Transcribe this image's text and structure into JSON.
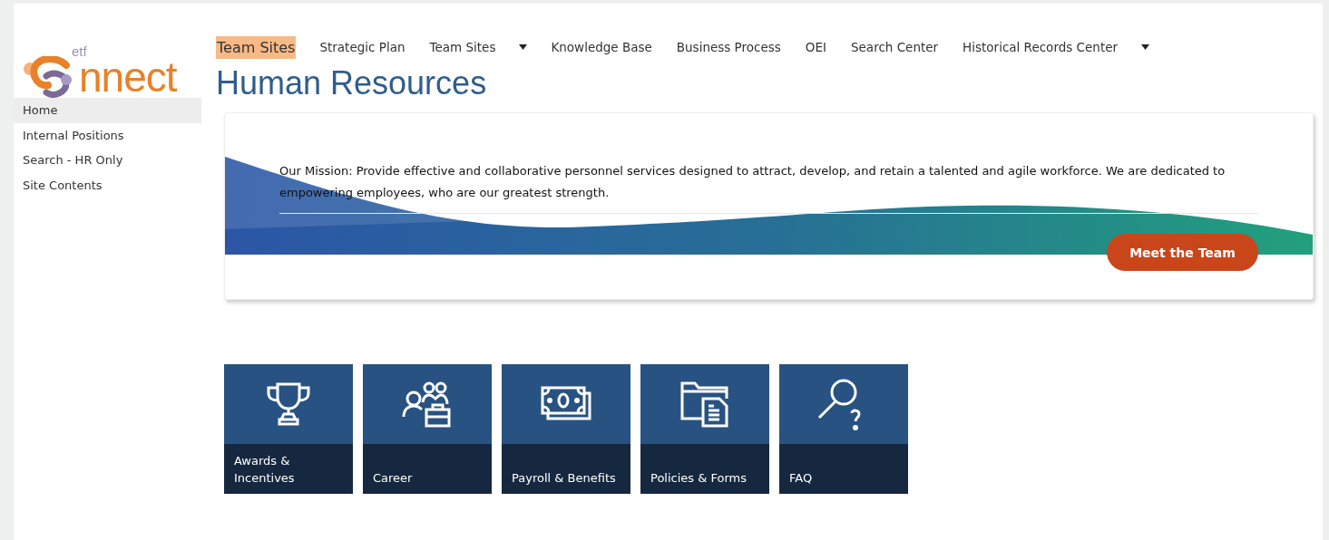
{
  "logo": {
    "superscript": "etf",
    "text": "nnect"
  },
  "nav": [
    {
      "label": "Team Sites",
      "selected": true,
      "has_menu": false
    },
    {
      "label": "Strategic Plan",
      "selected": false,
      "has_menu": false
    },
    {
      "label": "Team Sites",
      "selected": false,
      "has_menu": true
    },
    {
      "label": "Knowledge Base",
      "selected": false,
      "has_menu": false
    },
    {
      "label": "Business Process",
      "selected": false,
      "has_menu": false
    },
    {
      "label": "OEI",
      "selected": false,
      "has_menu": false
    },
    {
      "label": "Search Center",
      "selected": false,
      "has_menu": false
    },
    {
      "label": "Historical Records Center",
      "selected": false,
      "has_menu": true
    }
  ],
  "page_title": "Human Resources",
  "sidebar": {
    "items": [
      {
        "label": "Home",
        "selected": true
      },
      {
        "label": "Internal Positions",
        "selected": false
      },
      {
        "label": "Search - HR Only",
        "selected": false
      },
      {
        "label": "Site Contents",
        "selected": false
      }
    ]
  },
  "hero": {
    "mission": "Our Mission: Provide effective and collaborative personnel services designed to attract, develop, and retain a talented and agile workforce. We are dedicated to empowering employees, who are our greatest strength.",
    "button": "Meet the Team"
  },
  "tiles": [
    {
      "kind": "trophy",
      "label": "Awards & Incentives"
    },
    {
      "kind": "people",
      "label": "Career"
    },
    {
      "kind": "money",
      "label": "Payroll & Benefits"
    },
    {
      "kind": "folder",
      "label": "Policies & Forms"
    },
    {
      "kind": "search",
      "label": "FAQ"
    }
  ]
}
